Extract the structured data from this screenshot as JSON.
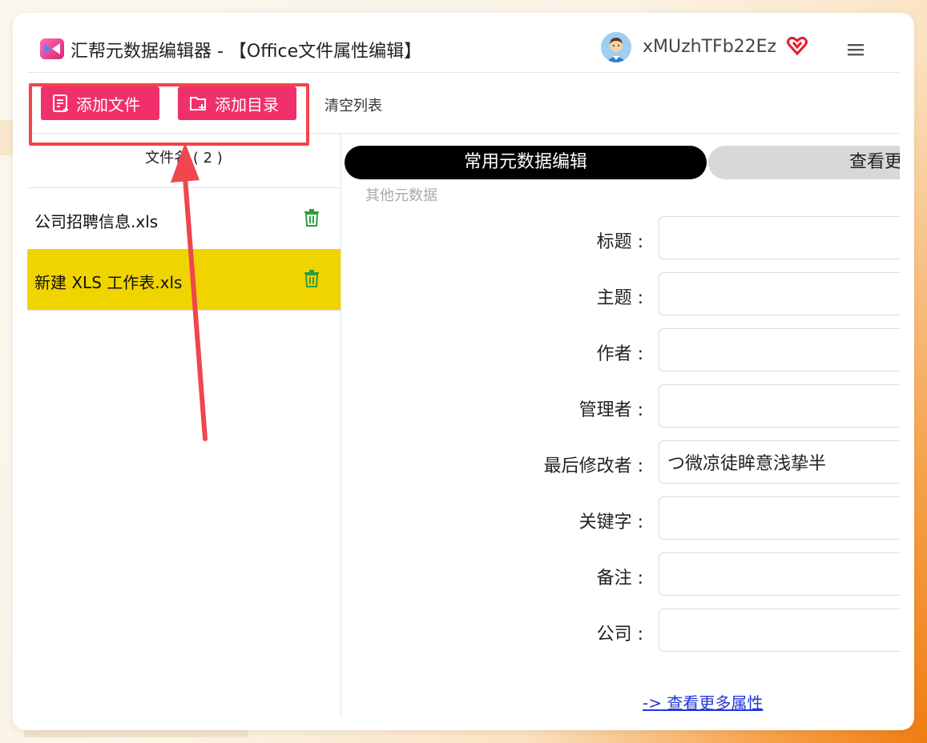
{
  "app": {
    "title": "汇帮元数据编辑器 - 【Office文件属性编辑】",
    "username": "xMUzhTFb22Ez"
  },
  "toolbar": {
    "add_file_label": "添加文件",
    "add_dir_label": "添加目录",
    "clear_label": "清空列表"
  },
  "file_list": {
    "header": "文件名 ( 2 )",
    "items": [
      {
        "name": "公司招聘信息.xls",
        "selected": false
      },
      {
        "name": "新建 XLS 工作表.xls",
        "selected": true
      }
    ]
  },
  "tabs": {
    "common": "常用元数据编辑",
    "more": "查看更多",
    "sub": "其他元数据"
  },
  "form": {
    "fields": [
      {
        "label": "标题 :",
        "value": ""
      },
      {
        "label": "主题 :",
        "value": ""
      },
      {
        "label": "作者 :",
        "value": ""
      },
      {
        "label": "管理者 :",
        "value": ""
      },
      {
        "label": "最后修改者 :",
        "value": "つ微凉徒眸意浅挚半"
      },
      {
        "label": "关键字 :",
        "value": ""
      },
      {
        "label": "备注 :",
        "value": ""
      },
      {
        "label": "公司 :",
        "value": ""
      }
    ]
  },
  "more_link": "-> 查看更多属性",
  "colors": {
    "accent": "#f0306a",
    "selected_row": "#f0d400",
    "highlight": "#f2434b",
    "link": "#2236d8"
  }
}
